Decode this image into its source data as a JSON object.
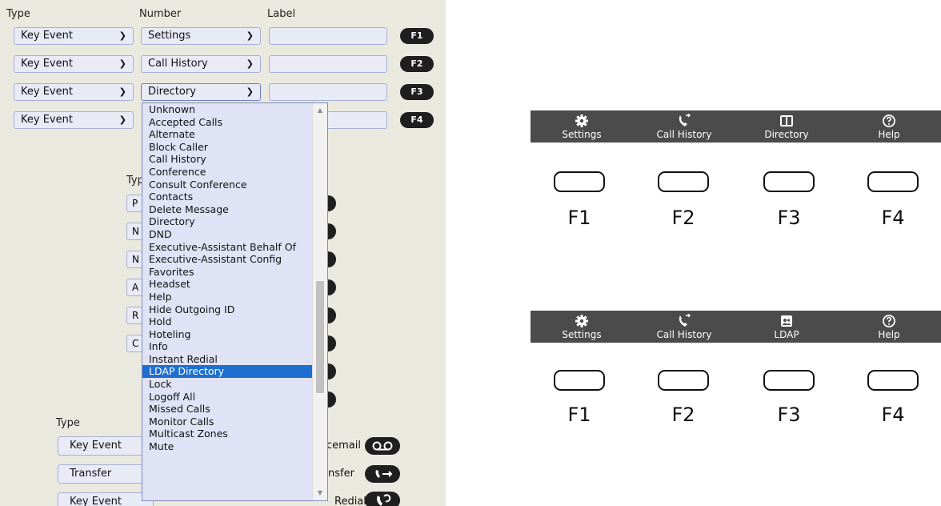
{
  "config": {
    "headers": {
      "type": "Type",
      "number": "Number",
      "label": "Label"
    },
    "rows": [
      {
        "type": "Key Event",
        "number": "Settings",
        "label": "",
        "key": "F1"
      },
      {
        "type": "Key Event",
        "number": "Call History",
        "label": "",
        "key": "F2"
      },
      {
        "type": "Key Event",
        "number": "Directory",
        "label": "",
        "key": "F3"
      },
      {
        "type": "Key Event",
        "number": "",
        "label": "",
        "key": "F4"
      }
    ],
    "partial_type_header": "Typ",
    "partial_letters": [
      "P",
      "N",
      "N",
      "A",
      "R",
      "C"
    ],
    "bottom": {
      "type_header": "Type",
      "rows": [
        {
          "type": "Key Event",
          "label": "Voicemail",
          "label_partial": "cemail",
          "icon": "voicemail-icon"
        },
        {
          "type": "Transfer",
          "label": "Transfer",
          "label_partial": "nsfer",
          "icon": "transfer-icon"
        },
        {
          "type": "Key Event",
          "label": "Redial",
          "label_partial": "Redial",
          "icon": "redial-icon"
        }
      ]
    },
    "dropdown": {
      "options": [
        "Unknown",
        "Accepted Calls",
        "Alternate",
        "Block Caller",
        "Call History",
        "Conference",
        "Consult Conference",
        "Contacts",
        "Delete Message",
        "Directory",
        "DND",
        "Executive-Assistant Behalf Of",
        "Executive-Assistant Config",
        "Favorites",
        "Headset",
        "Help",
        "Hide Outgoing ID",
        "Hold",
        "Hoteling",
        "Info",
        "Instant Redial",
        "LDAP Directory",
        "Lock",
        "Logoff All",
        "Missed Calls",
        "Monitor Calls",
        "Multicast Zones",
        "Mute"
      ],
      "selected": "LDAP Directory"
    }
  },
  "preview1": {
    "items": [
      {
        "label": "Settings",
        "icon": "gear-icon"
      },
      {
        "label": "Call History",
        "icon": "call-history-icon"
      },
      {
        "label": "Directory",
        "icon": "book-icon"
      },
      {
        "label": "Help",
        "icon": "help-icon"
      }
    ],
    "keys": [
      "F1",
      "F2",
      "F3",
      "F4"
    ]
  },
  "preview2": {
    "items": [
      {
        "label": "Settings",
        "icon": "gear-icon"
      },
      {
        "label": "Call History",
        "icon": "call-history-icon"
      },
      {
        "label": "LDAP",
        "icon": "ldap-icon"
      },
      {
        "label": "Help",
        "icon": "help-icon"
      }
    ],
    "keys": [
      "F1",
      "F2",
      "F3",
      "F4"
    ]
  },
  "colors": {
    "panel_bg": "#e9e9df",
    "select_bg": "#e8eaf6",
    "highlight": "#1e6fcf",
    "bar_bg": "#4b4b4b"
  }
}
